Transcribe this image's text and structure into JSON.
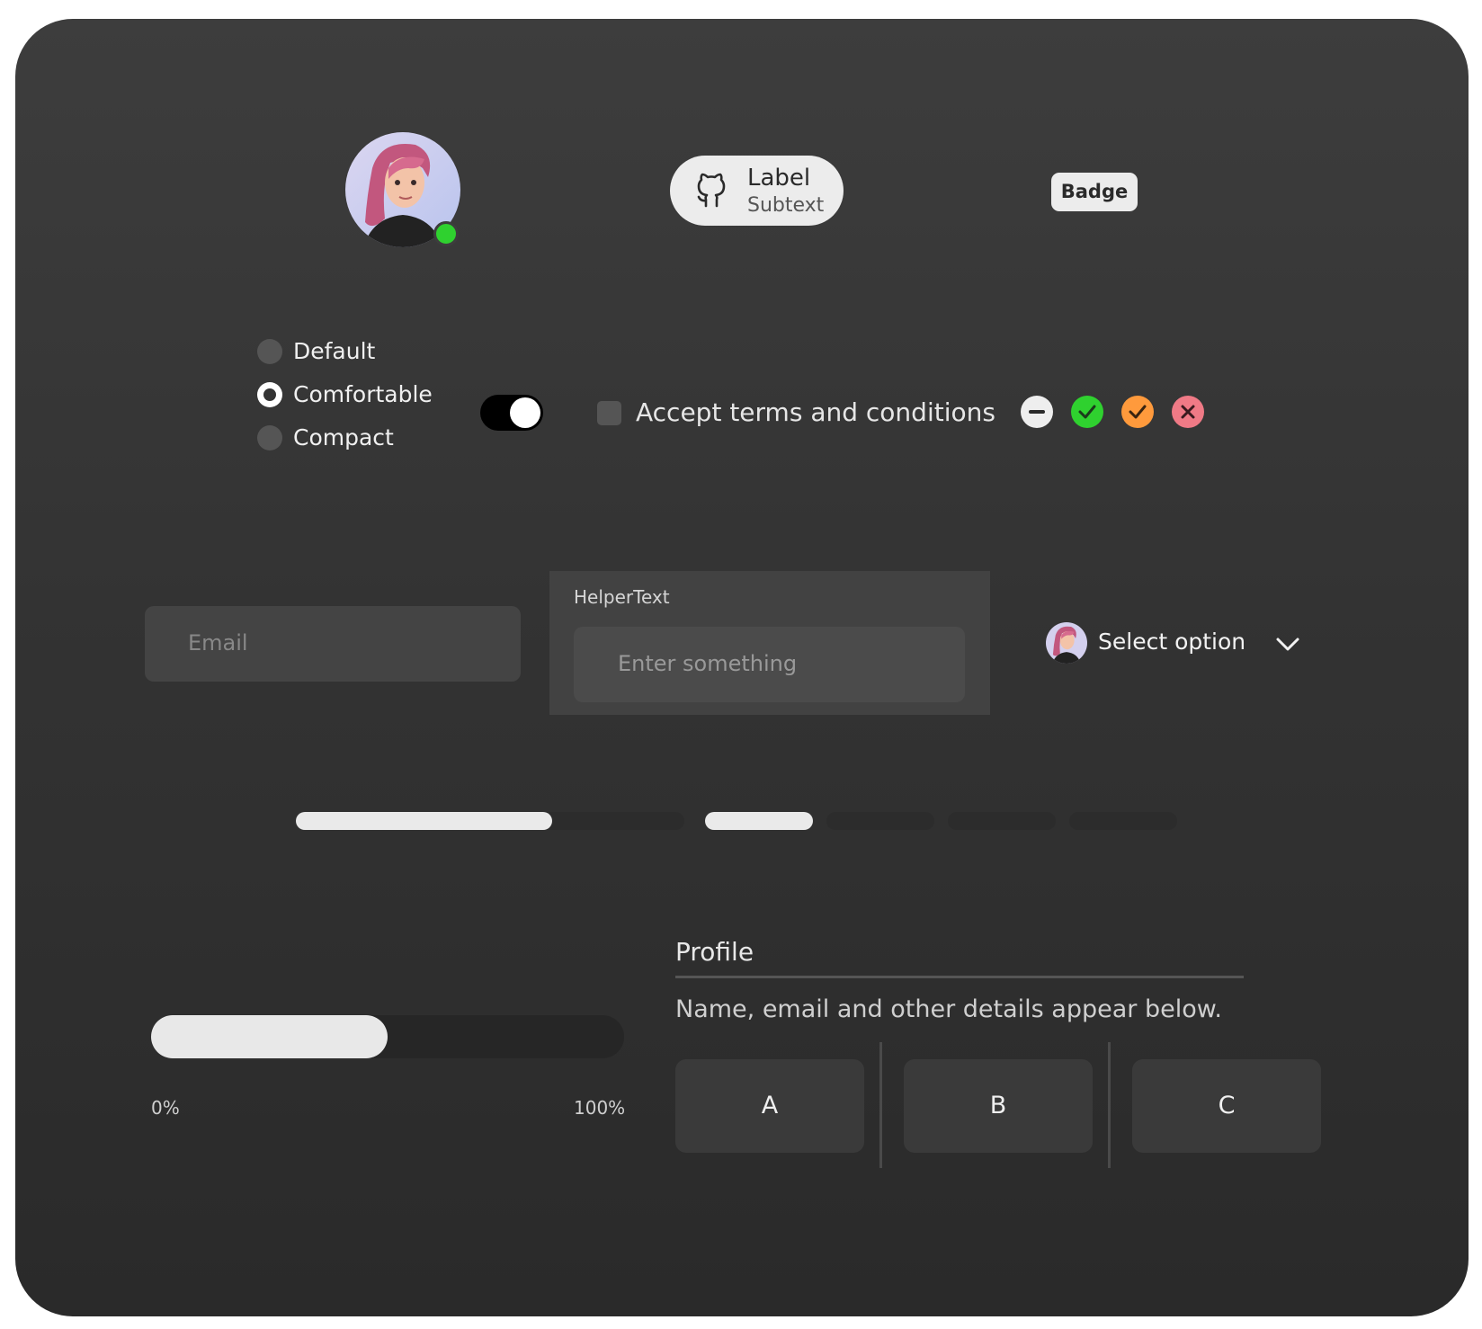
{
  "avatar": {
    "status": "online",
    "status_color": "#2fd12f"
  },
  "chip": {
    "icon": "github-icon",
    "label": "Label",
    "subtext": "Subtext"
  },
  "badge": {
    "label": "Badge"
  },
  "density": {
    "options": [
      "Default",
      "Comfortable",
      "Compact"
    ],
    "selected": "Comfortable"
  },
  "toggle": {
    "on": true
  },
  "terms": {
    "label": "Accept terms and conditions",
    "checked": false
  },
  "status_icons": [
    {
      "name": "minus-circle-icon",
      "color": "#eeeeee"
    },
    {
      "name": "check-circle-green-icon",
      "color": "#2fd12f"
    },
    {
      "name": "check-circle-orange-icon",
      "color": "#ff9a3c"
    },
    {
      "name": "close-circle-icon",
      "color": "#f07a86"
    }
  ],
  "email": {
    "placeholder": "Email",
    "value": ""
  },
  "helper": {
    "helper_text": "HelperText",
    "placeholder": "Enter something",
    "value": ""
  },
  "select": {
    "label": "Select option",
    "icon": "chevron-down-icon"
  },
  "linear_progress": {
    "value": 0.66
  },
  "step_progress": {
    "total": 4,
    "completed": 1
  },
  "slider": {
    "value": 0.5,
    "min_label": "0%",
    "max_label": "100%"
  },
  "profile": {
    "title": "Profile",
    "description": "Name, email and other details appear below.",
    "segments": [
      "A",
      "B",
      "C"
    ]
  }
}
